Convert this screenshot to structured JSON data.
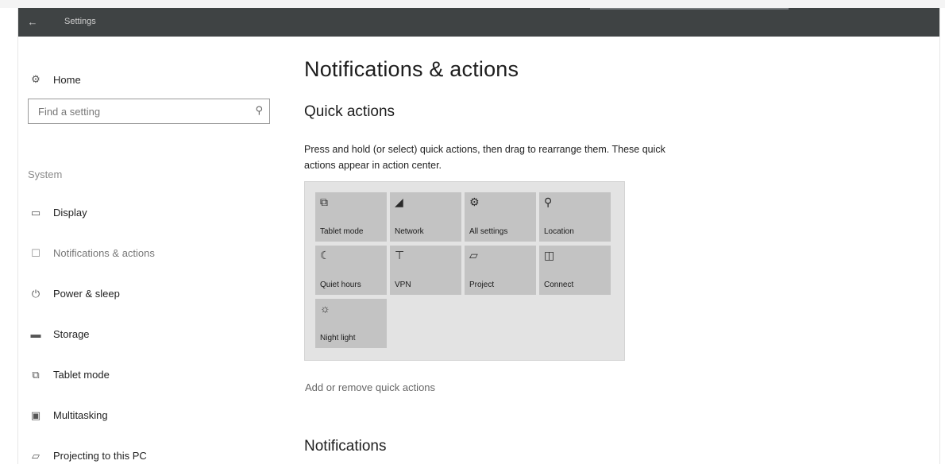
{
  "window": {
    "title": "Settings"
  },
  "sidebar": {
    "home": {
      "label": "Home",
      "icon": "gear-icon"
    },
    "search": {
      "placeholder": "Find a setting",
      "icon": "search-icon"
    },
    "section": "System",
    "items": [
      {
        "label": "Display",
        "icon": "monitor-icon"
      },
      {
        "label": "Notifications & actions",
        "icon": "notifications-icon",
        "active": true
      },
      {
        "label": "Power & sleep",
        "icon": "power-icon"
      },
      {
        "label": "Storage",
        "icon": "storage-icon"
      },
      {
        "label": "Tablet mode",
        "icon": "tablet-icon"
      },
      {
        "label": "Multitasking",
        "icon": "multitasking-icon"
      },
      {
        "label": "Projecting to this PC",
        "icon": "projecting-icon"
      }
    ]
  },
  "main": {
    "title": "Notifications & actions",
    "quick_actions": {
      "title": "Quick actions",
      "description": "Press and hold (or select) quick actions, then drag to rearrange them. These quick actions appear in action center.",
      "tiles": [
        {
          "label": "Tablet mode",
          "icon": "tablet-icon"
        },
        {
          "label": "Network",
          "icon": "network-icon"
        },
        {
          "label": "All settings",
          "icon": "gear-icon"
        },
        {
          "label": "Location",
          "icon": "location-icon"
        },
        {
          "label": "Quiet hours",
          "icon": "moon-icon"
        },
        {
          "label": "VPN",
          "icon": "vpn-icon"
        },
        {
          "label": "Project",
          "icon": "project-icon"
        },
        {
          "label": "Connect",
          "icon": "connect-icon"
        },
        {
          "label": "Night light",
          "icon": "brightness-icon"
        }
      ],
      "link": "Add or remove quick actions"
    },
    "notifications_title": "Notifications"
  }
}
